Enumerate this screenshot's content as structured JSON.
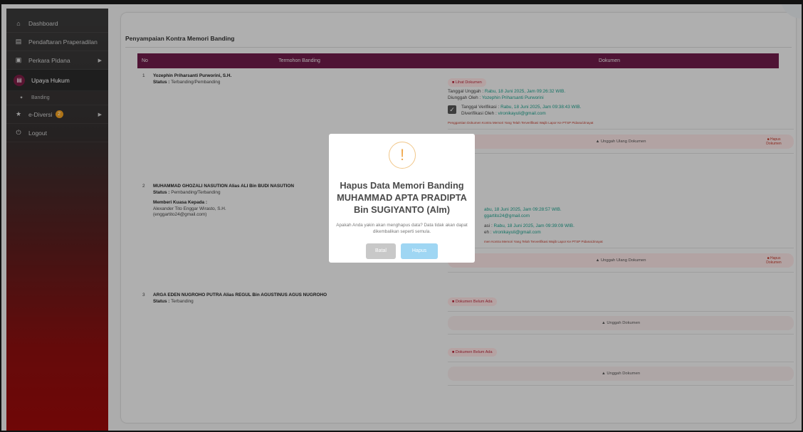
{
  "sidebar": {
    "items": [
      {
        "label": "Dashboard"
      },
      {
        "label": "Pendaftaran Praperadilan"
      },
      {
        "label": "Perkara Pidana"
      },
      {
        "label": "Upaya Hukum"
      },
      {
        "label": "Banding"
      },
      {
        "label": "e-Diversi",
        "badge": "2"
      },
      {
        "label": "Logout"
      }
    ]
  },
  "main": {
    "title": "Penyampaian Kontra Memori Banding",
    "columns": {
      "no": "No",
      "termohon": "Termohon Banding",
      "dokumen": "Dokumen"
    },
    "rows": [
      {
        "no": "1",
        "name": "Yozephin Priharsanti Purworini, S.H.",
        "status_label": "Status :",
        "status": "Terbanding/Pembanding",
        "doc_pill": "Lihat Dokumen",
        "upload_label": "Tanggal Unggah :",
        "upload_value": "Rabu, 18 Juni 2025, Jam 09:26:32 WIB.",
        "by_label": "Diunggah Oleh :",
        "by_value": "Yozephin Priharsanti Purworini",
        "verif_label": "Tanggal Verifikasi :",
        "verif_value": "Rabu, 18 Juni 2025, Jam 09:38:43 WIB.",
        "verif_by_label": "Diverifikasi Oleh :",
        "verif_by_value": "vironikayuli@gmail.com",
        "warning": "Penggantian Dokumen Kontra Memori Yang Telah Terverifikasi Wajib Lapor Ke PTSP Pidana/Jinayat",
        "reupload": "Unggah Ulang Dokumen",
        "delete": "Hapus Dokumen"
      },
      {
        "no": "2",
        "name": "MUHAMMAD GHOZALI NASUTION Alias ALI Bin BUDI NASUTION",
        "status_label": "Status :",
        "status": "Pembanding/Terbanding",
        "kuasa_label": "Memberi Kuasa Kepada :",
        "kuasa_name": "Alexander Tito Enggar Wirasto, S.H.",
        "kuasa_email": "(enggartito24@gmail.com)",
        "upload_value": "abu, 18 Juni 2025, Jam 09:28:57 WIB.",
        "by_value": "ggartito24@gmail.com",
        "verif_label": "asi :",
        "verif_value": "Rabu, 18 Juni 2025, Jam 09:39:09 WIB.",
        "verif_by_label": "eh :",
        "verif_by_value": "vironikayuli@gmail.com",
        "warning": "men Kontra Memori Yang Telah Terverifikasi Wajib Lapor Ke PTSP Pidana/Jinayat",
        "reupload": "Unggah Ulang Dokumen",
        "delete": "Hapus Dokumen"
      },
      {
        "no": "3",
        "name": "ARGA EDEN NUGROHO PUTRA Alias REGUL Bin AGUSTINUS AGUS NUGROHO",
        "status_label": "Status :",
        "status": "Terbanding",
        "doc_pill_1": "Dokumen Belum Ada",
        "upload_1": "Unggah Dokumen",
        "doc_pill_2": "Dokumen Belum Ada",
        "upload_2": "Unggah Dokumen"
      }
    ]
  },
  "modal": {
    "icon": "warning-icon",
    "title": "Hapus Data Memori Banding MUHAMMAD APTA PRADIPTA Bin SUGIYANTO (Alm)",
    "message": "Apakah Anda yakin akan menghapus data? Data tidak akan dapat dikembalikan seperti semula.",
    "cancel": "Batal",
    "confirm": "Hapus"
  },
  "colors": {
    "table_header": "#6e1d4a",
    "teal_text": "#1a9e8a",
    "confirm_button": "#9fd6f3",
    "cancel_button": "#c8c8c8"
  }
}
